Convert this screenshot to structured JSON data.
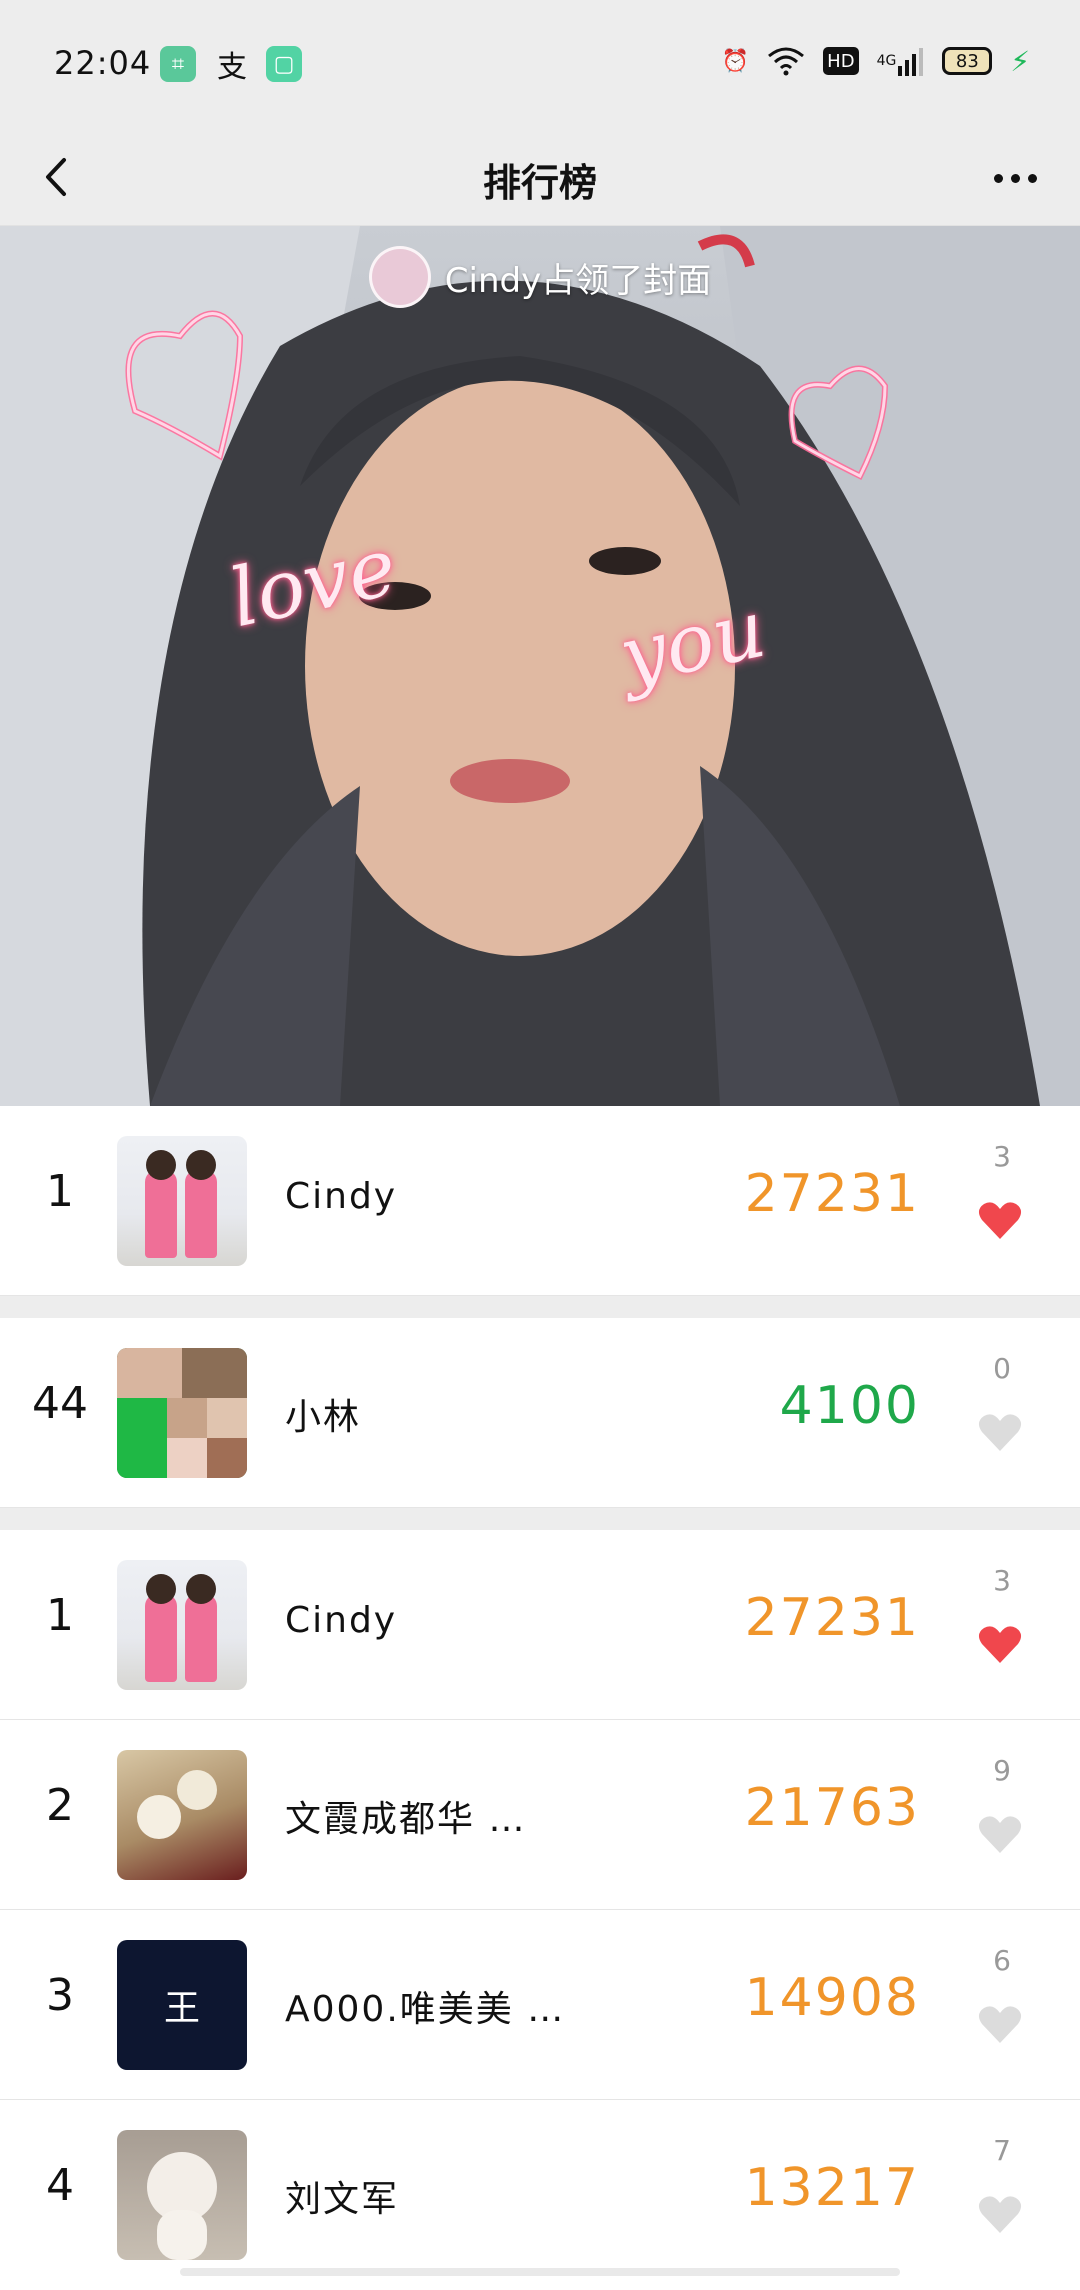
{
  "status_bar": {
    "time": "22:04",
    "battery": "83",
    "network": "4G",
    "hd": "HD"
  },
  "header": {
    "title": "排行榜"
  },
  "cover": {
    "label": "Cindy占领了封面"
  },
  "my_row": {
    "rank": "1",
    "name": "Cindy",
    "steps": "27231",
    "likes": "3",
    "liked": true
  },
  "friend_row": {
    "rank": "44",
    "name": "小林",
    "steps": "4100",
    "likes": "0",
    "liked": false
  },
  "ranking": [
    {
      "rank": "1",
      "name": "Cindy",
      "steps": "27231",
      "likes": "3",
      "liked": true
    },
    {
      "rank": "2",
      "name": "文霞成都华 …",
      "steps": "21763",
      "likes": "9",
      "liked": false
    },
    {
      "rank": "3",
      "name": "A000.唯美美 …",
      "steps": "14908",
      "likes": "6",
      "liked": false
    },
    {
      "rank": "4",
      "name": "刘文军",
      "steps": "13217",
      "likes": "7",
      "liked": false
    }
  ],
  "thumb_text": {
    "wang": "王"
  },
  "colors": {
    "steps_high": "#f0952a",
    "steps_low": "#1fa84a",
    "heart_active": "#f0474d",
    "heart_inactive": "#dcdcdc",
    "background": "#ededed"
  }
}
